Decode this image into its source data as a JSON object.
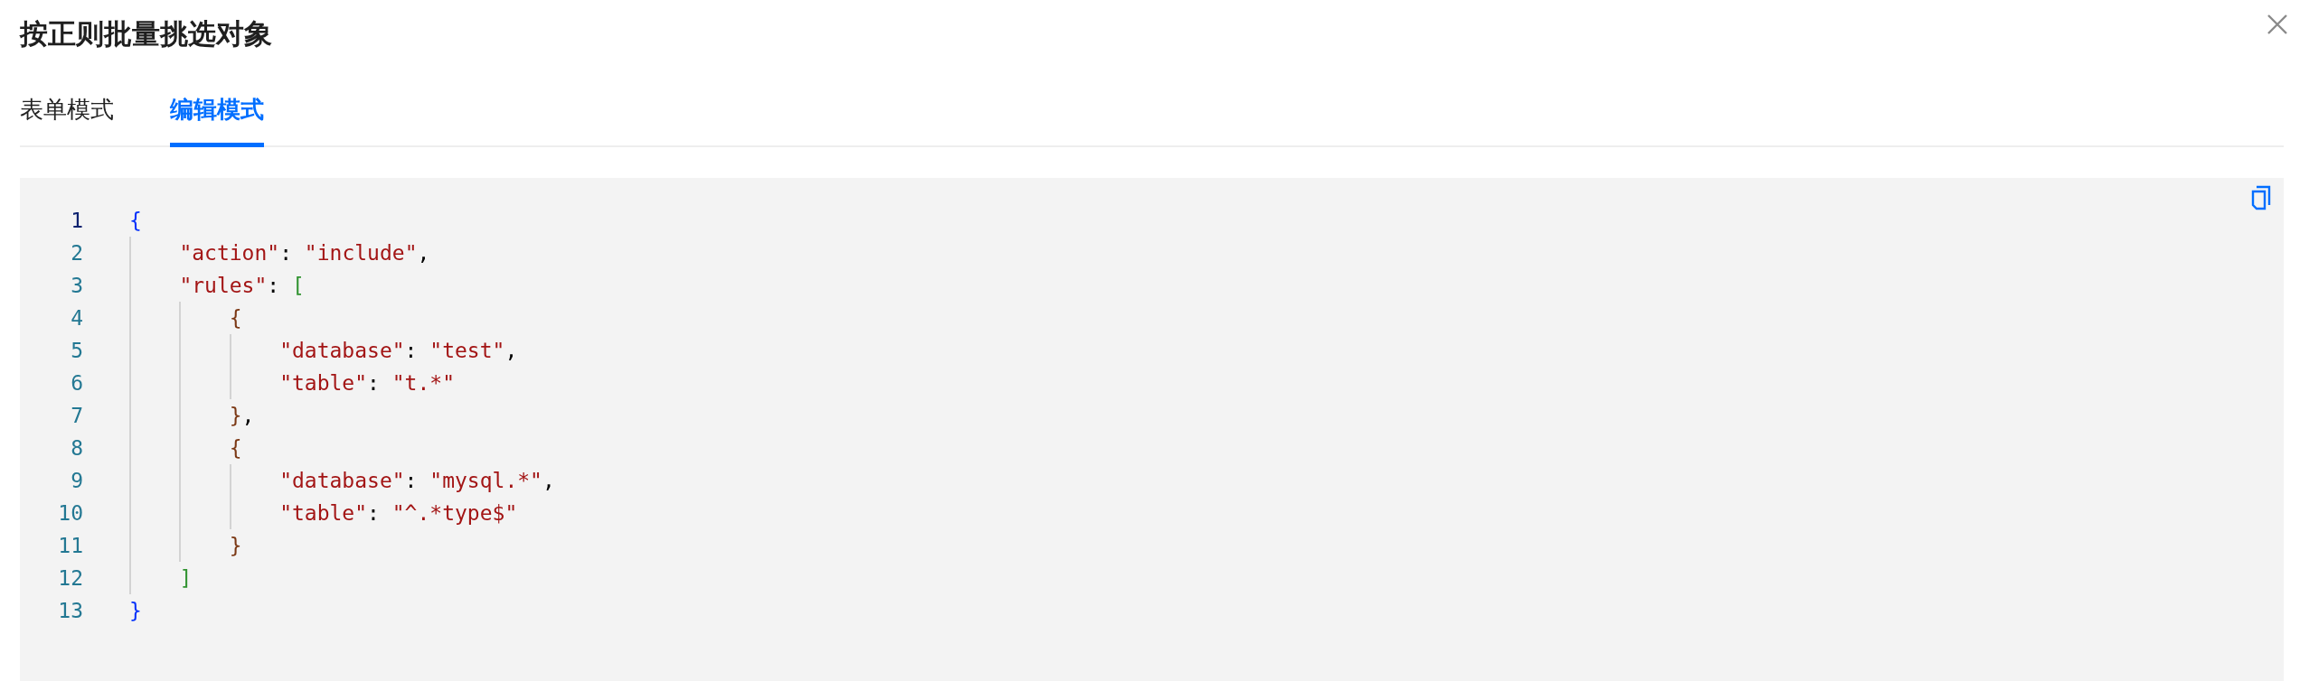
{
  "dialog": {
    "title": "按正则批量挑选对象"
  },
  "tabs": [
    {
      "label": "表单模式",
      "selected": false
    },
    {
      "label": "编辑模式",
      "selected": true
    }
  ],
  "editor": {
    "lines": [
      {
        "number": "1",
        "active": true,
        "tokens": [
          {
            "kind": "bracket",
            "text": "{",
            "color": "#0431fa"
          }
        ],
        "children": [
          {
            "number": "2",
            "active": false,
            "tokens": [
              {
                "kind": "string",
                "text": "\"action\""
              },
              {
                "kind": "punct",
                "text": ": "
              },
              {
                "kind": "string",
                "text": "\"include\""
              },
              {
                "kind": "punct",
                "text": ","
              }
            ]
          },
          {
            "number": "3",
            "active": false,
            "tokens": [
              {
                "kind": "string",
                "text": "\"rules\""
              },
              {
                "kind": "punct",
                "text": ": "
              },
              {
                "kind": "bracket",
                "text": "[",
                "color": "#319331"
              }
            ],
            "children": [
              {
                "number": "4",
                "active": false,
                "tokens": [
                  {
                    "kind": "bracket",
                    "text": "{",
                    "color": "#7b3814"
                  }
                ],
                "children": [
                  {
                    "number": "5",
                    "active": false,
                    "tokens": [
                      {
                        "kind": "string",
                        "text": "\"database\""
                      },
                      {
                        "kind": "punct",
                        "text": ": "
                      },
                      {
                        "kind": "string",
                        "text": "\"test\""
                      },
                      {
                        "kind": "punct",
                        "text": ","
                      }
                    ]
                  },
                  {
                    "number": "6",
                    "active": false,
                    "tokens": [
                      {
                        "kind": "string",
                        "text": "\"table\""
                      },
                      {
                        "kind": "punct",
                        "text": ": "
                      },
                      {
                        "kind": "string",
                        "text": "\"t.*\""
                      }
                    ]
                  }
                ]
              },
              {
                "number": "7",
                "active": false,
                "tokens": [
                  {
                    "kind": "bracket",
                    "text": "}",
                    "color": "#7b3814"
                  },
                  {
                    "kind": "punct",
                    "text": ","
                  }
                ]
              },
              {
                "number": "8",
                "active": false,
                "tokens": [
                  {
                    "kind": "bracket",
                    "text": "{",
                    "color": "#7b3814"
                  }
                ],
                "children": [
                  {
                    "number": "9",
                    "active": false,
                    "tokens": [
                      {
                        "kind": "string",
                        "text": "\"database\""
                      },
                      {
                        "kind": "punct",
                        "text": ": "
                      },
                      {
                        "kind": "string",
                        "text": "\"mysql.*\""
                      },
                      {
                        "kind": "punct",
                        "text": ","
                      }
                    ]
                  },
                  {
                    "number": "10",
                    "active": false,
                    "tokens": [
                      {
                        "kind": "string",
                        "text": "\"table\""
                      },
                      {
                        "kind": "punct",
                        "text": ": "
                      },
                      {
                        "kind": "string",
                        "text": "\"^.*type$\""
                      }
                    ]
                  }
                ]
              },
              {
                "number": "11",
                "active": false,
                "tokens": [
                  {
                    "kind": "bracket",
                    "text": "}",
                    "color": "#7b3814"
                  }
                ]
              }
            ]
          },
          {
            "number": "12",
            "active": false,
            "tokens": [
              {
                "kind": "bracket",
                "text": "]",
                "color": "#319331"
              }
            ]
          }
        ]
      },
      {
        "number": "13",
        "active": false,
        "tokens": [
          {
            "kind": "bracket",
            "text": "}",
            "color": "#0431fa"
          }
        ]
      }
    ]
  }
}
